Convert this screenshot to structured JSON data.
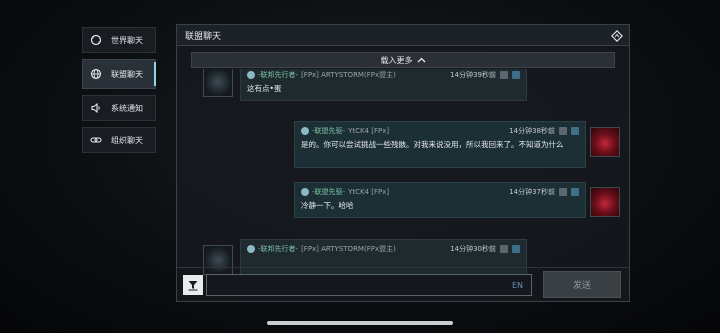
{
  "sidebar": {
    "items": [
      {
        "label": "世界聊天",
        "icon": "globe-refresh-icon"
      },
      {
        "label": "联盟聊天",
        "icon": "globe-icon",
        "active": true
      },
      {
        "label": "系统通知",
        "icon": "speaker-icon"
      },
      {
        "label": "组织聊天",
        "icon": "chain-link-icon"
      }
    ]
  },
  "header": {
    "title": "联盟聊天",
    "icon": "diamond-arrow-icon"
  },
  "load_more": {
    "label": "载入更多",
    "icon": "chevron-up-icon"
  },
  "messages": [
    {
      "sender": "-联邦先行者-",
      "player": "[FPx] ARTYSTORM(FPx盟主)",
      "time": "14分钟39秒前",
      "text": "这有点•蛋"
    },
    {
      "sender": "-联盟先驱-",
      "player": "YtCK4 [FPx]",
      "time": "14分钟38秒前",
      "text": "是的。你可以尝试挑战一些残骸。对我来说没用，所以我回来了。不知道为什么"
    },
    {
      "sender": "-联盟先驱-",
      "player": "YtCK4 [FPx]",
      "time": "14分钟37秒前",
      "text": "冷静一下。哈哈"
    },
    {
      "sender": "-联邦先行者-",
      "player": "[FPx] ARTYSTORM(FPx盟主)",
      "time": "14分钟30秒前",
      "text": ""
    }
  ],
  "input": {
    "value": "",
    "lang": "EN"
  },
  "send_button": {
    "label": "发送"
  },
  "colors": {
    "accent": "#8fd3e8",
    "guild_name": "#7fc1a9"
  }
}
